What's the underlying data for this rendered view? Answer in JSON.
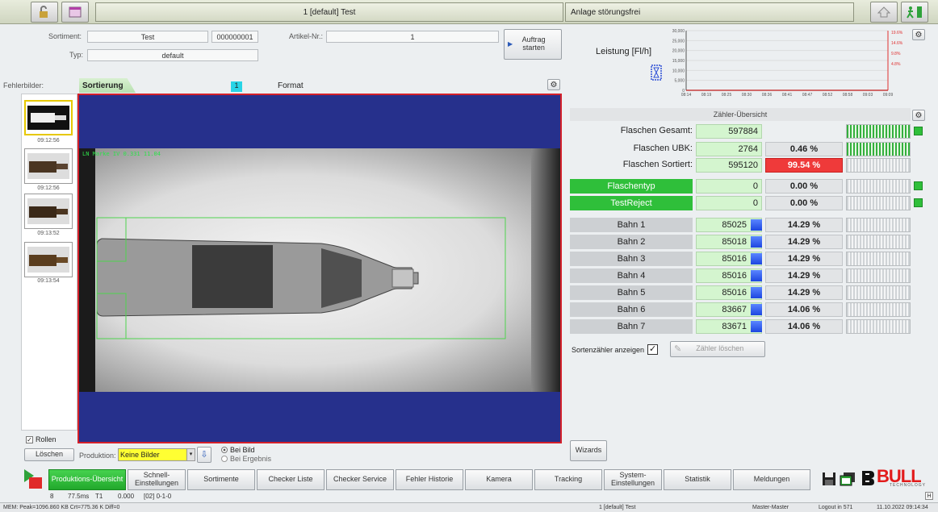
{
  "header": {
    "center_title": "1 [default] Test",
    "status_text": "Anlage störungsfrei"
  },
  "product": {
    "sortiment_label": "Sortiment:",
    "sortiment_value": "Test",
    "sortiment_number": "000000001",
    "typ_label": "Typ:",
    "typ_value": "default",
    "artikel_label": "Artikel-Nr.:",
    "artikel_value": "1",
    "start_button": "Auftrag starten"
  },
  "left_panel": {
    "fehlerbilder_label": "Fehlerbilder:",
    "thumbnails": [
      {
        "time": "09:12:56"
      },
      {
        "time": "09:12:56"
      },
      {
        "time": "09:13:52"
      },
      {
        "time": "09:13:54"
      }
    ],
    "rollen_label": "Rollen",
    "loeschen_button": "Löschen"
  },
  "image_panel": {
    "tab_label": "Sortierung",
    "badge": "1",
    "format_label": "Format",
    "overlay_text": "LN Marke IV 0.331   11.04"
  },
  "production": {
    "label": "Produktion:",
    "select_value": "Keine Bilder",
    "radio1": "Bei Bild",
    "radio2": "Bei Ergebnis",
    "wizards": "Wizards"
  },
  "chart_data": {
    "type": "line",
    "title": "Leistung [Fl/h]",
    "xlabel": "",
    "ylabel": "",
    "ylim": [
      0,
      30000
    ],
    "y_ticks": [
      "30,000",
      "25,000",
      "20,000",
      "15,000",
      "10,000",
      "5,000",
      "0"
    ],
    "y_ticks_right": [
      "19.6%",
      "14.6%",
      "9.8%",
      "4.8%"
    ],
    "categories": [
      "08:14",
      "08:19",
      "08:25",
      "08:30",
      "08:36",
      "08:41",
      "08:47",
      "08:52",
      "08:58",
      "09:03",
      "09:09"
    ],
    "series": [
      {
        "values": [
          0,
          0,
          0,
          0,
          0,
          0,
          0,
          0,
          0,
          0,
          0
        ]
      }
    ],
    "grid": true
  },
  "counters": {
    "title": "Zähler-Übersicht",
    "summary": [
      {
        "label": "Flaschen Gesamt:",
        "value": "597884",
        "pct": ""
      },
      {
        "label": "Flaschen UBK:",
        "value": "2764",
        "pct": "0.46 %"
      },
      {
        "label": "Flaschen Sortiert:",
        "value": "595120",
        "pct": "99.54 %"
      }
    ],
    "rejects": [
      {
        "label": "Flaschentyp",
        "value": "0",
        "pct": "0.00 %"
      },
      {
        "label": "TestReject",
        "value": "0",
        "pct": "0.00 %"
      }
    ],
    "lanes": [
      {
        "label": "Bahn 1",
        "value": "85025",
        "pct": "14.29 %"
      },
      {
        "label": "Bahn 2",
        "value": "85018",
        "pct": "14.29 %"
      },
      {
        "label": "Bahn 3",
        "value": "85016",
        "pct": "14.29 %"
      },
      {
        "label": "Bahn 4",
        "value": "85016",
        "pct": "14.29 %"
      },
      {
        "label": "Bahn 5",
        "value": "85016",
        "pct": "14.29 %"
      },
      {
        "label": "Bahn 6",
        "value": "83667",
        "pct": "14.06 %"
      },
      {
        "label": "Bahn 7",
        "value": "83671",
        "pct": "14.06 %"
      }
    ],
    "sortenzaehler_label": "Sortenzähler anzeigen",
    "zaehler_loeschen": "Zähler löschen"
  },
  "tabs": [
    "Produktions-Übersicht",
    "Schnell-Einstellungen",
    "Sortimente",
    "Checker Liste",
    "Checker Service",
    "Fehler Historie",
    "Kamera",
    "Tracking",
    "System-Einstellungen",
    "Statistik",
    "Meldungen"
  ],
  "brand": {
    "name": "BULL",
    "sub": "TECHNOLOGY"
  },
  "info_line": {
    "a": "8",
    "b": "77.5ms",
    "c": "T1",
    "d": "0.000",
    "e": "[02] 0-1-0"
  },
  "status_bar": {
    "mem": "MEM: Peak=1096.860 KB  Crt=775.36 K  Diff=0",
    "job": "1 [default] Test",
    "user": "Master-Master",
    "logout": "Logout in 571",
    "datetime": "11.10.2022 09:14:34"
  },
  "colors": {
    "accent_green": "#2fbf3a",
    "alert_red": "#ef3a3a",
    "frame_red": "#d4202a",
    "camera_blue": "#26308c"
  }
}
